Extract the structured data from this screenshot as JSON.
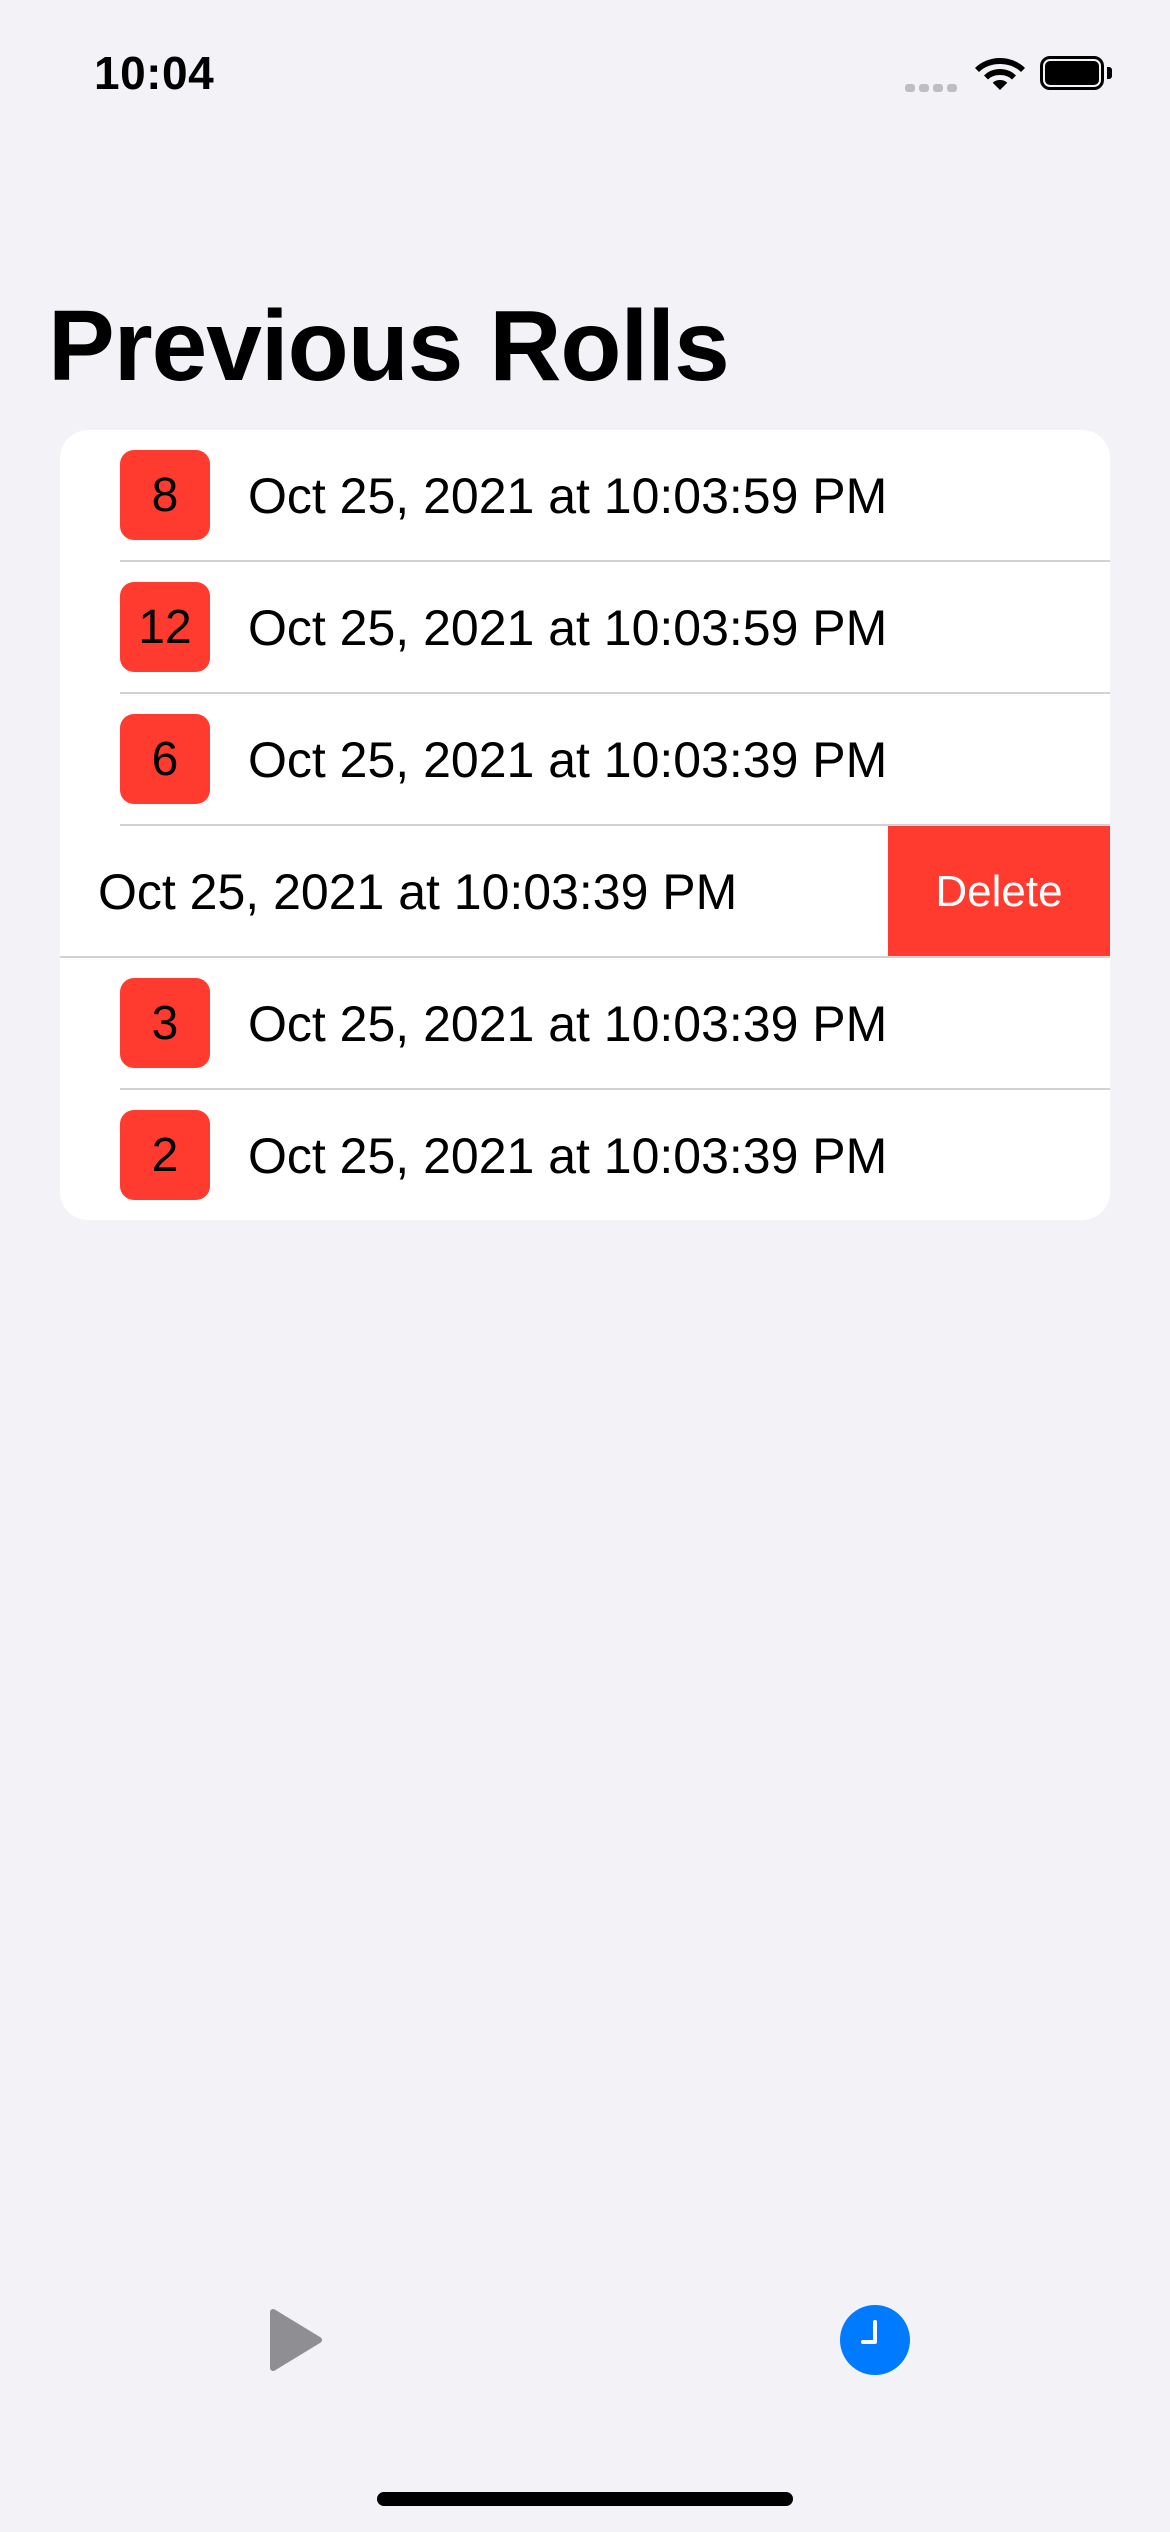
{
  "status_bar": {
    "time": "10:04"
  },
  "title": "Previous Rolls",
  "rolls": [
    {
      "value": "8",
      "date": "Oct 25, 2021 at 10:03:59 PM"
    },
    {
      "value": "12",
      "date": "Oct 25, 2021 at 10:03:59 PM"
    },
    {
      "value": "6",
      "date": "Oct 25, 2021 at 10:03:39 PM"
    },
    {
      "value": "",
      "date": "Oct 25, 2021 at 10:03:39 PM"
    },
    {
      "value": "3",
      "date": "Oct 25, 2021 at 10:03:39 PM"
    },
    {
      "value": "2",
      "date": "Oct 25, 2021 at 10:03:39 PM"
    }
  ],
  "swipe_action": {
    "label": "Delete"
  },
  "tab_bar": {
    "items": [
      {
        "icon": "play-icon",
        "selected": false
      },
      {
        "icon": "clock-icon",
        "selected": true
      }
    ]
  },
  "colors": {
    "background": "#F2F2F7",
    "badge": "#FF3B30",
    "delete": "#FF3B30",
    "accent": "#007AFF",
    "inactive_tab": "#8E8E93"
  }
}
